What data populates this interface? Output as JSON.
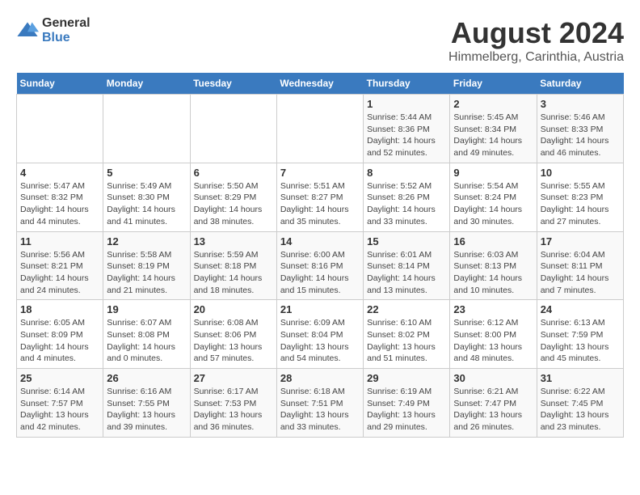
{
  "logo": {
    "general": "General",
    "blue": "Blue"
  },
  "title": "August 2024",
  "subtitle": "Himmelberg, Carinthia, Austria",
  "days_header": [
    "Sunday",
    "Monday",
    "Tuesday",
    "Wednesday",
    "Thursday",
    "Friday",
    "Saturday"
  ],
  "weeks": [
    [
      {
        "day": "",
        "info": ""
      },
      {
        "day": "",
        "info": ""
      },
      {
        "day": "",
        "info": ""
      },
      {
        "day": "",
        "info": ""
      },
      {
        "day": "1",
        "info": "Sunrise: 5:44 AM\nSunset: 8:36 PM\nDaylight: 14 hours and 52 minutes."
      },
      {
        "day": "2",
        "info": "Sunrise: 5:45 AM\nSunset: 8:34 PM\nDaylight: 14 hours and 49 minutes."
      },
      {
        "day": "3",
        "info": "Sunrise: 5:46 AM\nSunset: 8:33 PM\nDaylight: 14 hours and 46 minutes."
      }
    ],
    [
      {
        "day": "4",
        "info": "Sunrise: 5:47 AM\nSunset: 8:32 PM\nDaylight: 14 hours and 44 minutes."
      },
      {
        "day": "5",
        "info": "Sunrise: 5:49 AM\nSunset: 8:30 PM\nDaylight: 14 hours and 41 minutes."
      },
      {
        "day": "6",
        "info": "Sunrise: 5:50 AM\nSunset: 8:29 PM\nDaylight: 14 hours and 38 minutes."
      },
      {
        "day": "7",
        "info": "Sunrise: 5:51 AM\nSunset: 8:27 PM\nDaylight: 14 hours and 35 minutes."
      },
      {
        "day": "8",
        "info": "Sunrise: 5:52 AM\nSunset: 8:26 PM\nDaylight: 14 hours and 33 minutes."
      },
      {
        "day": "9",
        "info": "Sunrise: 5:54 AM\nSunset: 8:24 PM\nDaylight: 14 hours and 30 minutes."
      },
      {
        "day": "10",
        "info": "Sunrise: 5:55 AM\nSunset: 8:23 PM\nDaylight: 14 hours and 27 minutes."
      }
    ],
    [
      {
        "day": "11",
        "info": "Sunrise: 5:56 AM\nSunset: 8:21 PM\nDaylight: 14 hours and 24 minutes."
      },
      {
        "day": "12",
        "info": "Sunrise: 5:58 AM\nSunset: 8:19 PM\nDaylight: 14 hours and 21 minutes."
      },
      {
        "day": "13",
        "info": "Sunrise: 5:59 AM\nSunset: 8:18 PM\nDaylight: 14 hours and 18 minutes."
      },
      {
        "day": "14",
        "info": "Sunrise: 6:00 AM\nSunset: 8:16 PM\nDaylight: 14 hours and 15 minutes."
      },
      {
        "day": "15",
        "info": "Sunrise: 6:01 AM\nSunset: 8:14 PM\nDaylight: 14 hours and 13 minutes."
      },
      {
        "day": "16",
        "info": "Sunrise: 6:03 AM\nSunset: 8:13 PM\nDaylight: 14 hours and 10 minutes."
      },
      {
        "day": "17",
        "info": "Sunrise: 6:04 AM\nSunset: 8:11 PM\nDaylight: 14 hours and 7 minutes."
      }
    ],
    [
      {
        "day": "18",
        "info": "Sunrise: 6:05 AM\nSunset: 8:09 PM\nDaylight: 14 hours and 4 minutes."
      },
      {
        "day": "19",
        "info": "Sunrise: 6:07 AM\nSunset: 8:08 PM\nDaylight: 14 hours and 0 minutes."
      },
      {
        "day": "20",
        "info": "Sunrise: 6:08 AM\nSunset: 8:06 PM\nDaylight: 13 hours and 57 minutes."
      },
      {
        "day": "21",
        "info": "Sunrise: 6:09 AM\nSunset: 8:04 PM\nDaylight: 13 hours and 54 minutes."
      },
      {
        "day": "22",
        "info": "Sunrise: 6:10 AM\nSunset: 8:02 PM\nDaylight: 13 hours and 51 minutes."
      },
      {
        "day": "23",
        "info": "Sunrise: 6:12 AM\nSunset: 8:00 PM\nDaylight: 13 hours and 48 minutes."
      },
      {
        "day": "24",
        "info": "Sunrise: 6:13 AM\nSunset: 7:59 PM\nDaylight: 13 hours and 45 minutes."
      }
    ],
    [
      {
        "day": "25",
        "info": "Sunrise: 6:14 AM\nSunset: 7:57 PM\nDaylight: 13 hours and 42 minutes."
      },
      {
        "day": "26",
        "info": "Sunrise: 6:16 AM\nSunset: 7:55 PM\nDaylight: 13 hours and 39 minutes."
      },
      {
        "day": "27",
        "info": "Sunrise: 6:17 AM\nSunset: 7:53 PM\nDaylight: 13 hours and 36 minutes."
      },
      {
        "day": "28",
        "info": "Sunrise: 6:18 AM\nSunset: 7:51 PM\nDaylight: 13 hours and 33 minutes."
      },
      {
        "day": "29",
        "info": "Sunrise: 6:19 AM\nSunset: 7:49 PM\nDaylight: 13 hours and 29 minutes."
      },
      {
        "day": "30",
        "info": "Sunrise: 6:21 AM\nSunset: 7:47 PM\nDaylight: 13 hours and 26 minutes."
      },
      {
        "day": "31",
        "info": "Sunrise: 6:22 AM\nSunset: 7:45 PM\nDaylight: 13 hours and 23 minutes."
      }
    ]
  ]
}
